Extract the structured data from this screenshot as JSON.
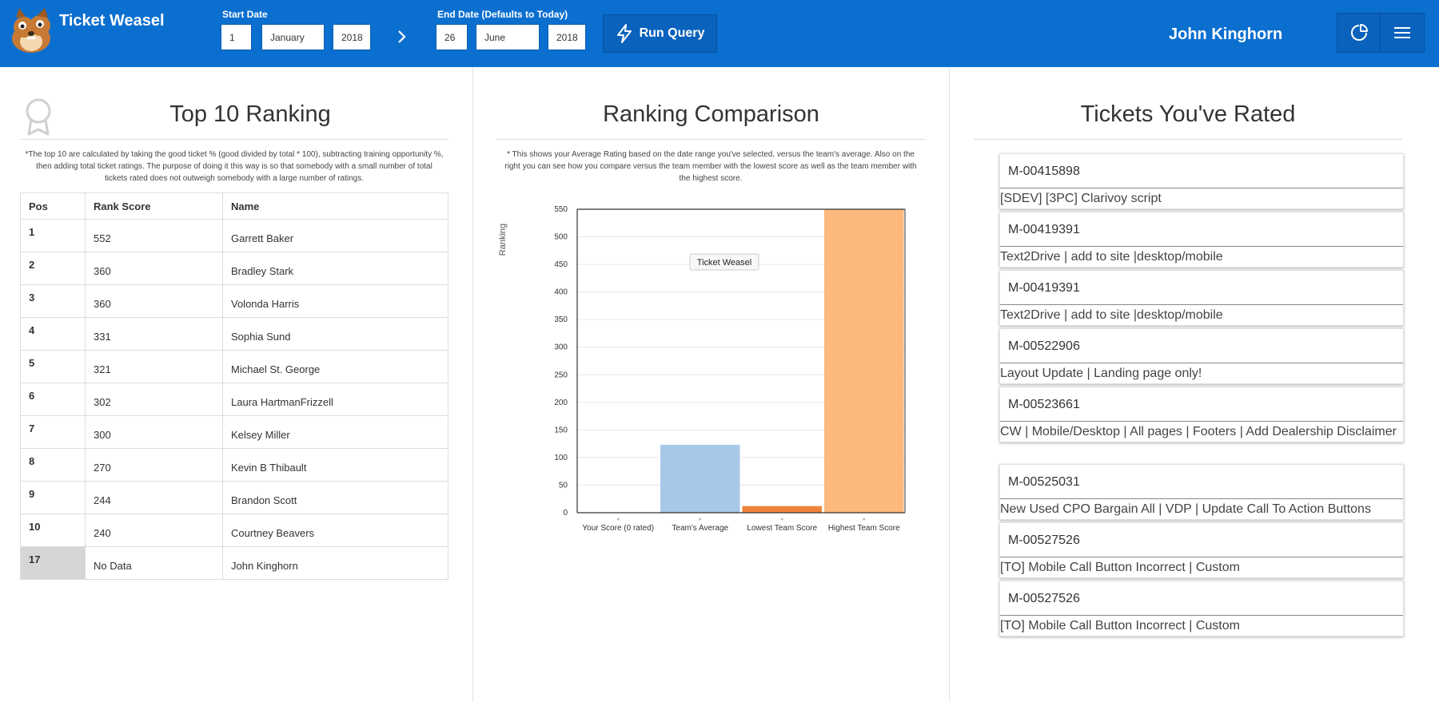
{
  "app": {
    "title": "Ticket Weasel"
  },
  "header": {
    "start_label": "Start Date",
    "start": {
      "day": "1",
      "month": "January",
      "year": "2018"
    },
    "end_label": "End Date (Defaults to Today)",
    "end": {
      "day": "26",
      "month": "June",
      "year": "2018"
    },
    "run_label": "Run Query",
    "user_name": "John Kinghorn"
  },
  "top10": {
    "title": "Top 10 Ranking",
    "note": "*The top 10 are calculated by taking the good ticket % (good divided by total * 100), subtracting training opportunity %, then adding total ticket ratings. The purpose of doing it this way is so that somebody with a small number of total tickets rated does not outweigh somebody with a large number of ratings.",
    "headers": [
      "Pos",
      "Rank Score",
      "Name"
    ],
    "rows": [
      {
        "pos": "1",
        "score": "552",
        "name": "Garrett Baker"
      },
      {
        "pos": "2",
        "score": "360",
        "name": "Bradley Stark"
      },
      {
        "pos": "3",
        "score": "360",
        "name": "Volonda Harris"
      },
      {
        "pos": "4",
        "score": "331",
        "name": "Sophia Sund"
      },
      {
        "pos": "5",
        "score": "321",
        "name": "Michael St. George"
      },
      {
        "pos": "6",
        "score": "302",
        "name": "Laura HartmanFrizzell"
      },
      {
        "pos": "7",
        "score": "300",
        "name": "Kelsey Miller"
      },
      {
        "pos": "8",
        "score": "270",
        "name": "Kevin B Thibault"
      },
      {
        "pos": "9",
        "score": "244",
        "name": "Brandon Scott"
      },
      {
        "pos": "10",
        "score": "240",
        "name": "Courtney Beavers"
      }
    ],
    "me": {
      "pos": "17",
      "score": "No Data",
      "name": "John Kinghorn"
    }
  },
  "comparison": {
    "title": "Ranking Comparison",
    "note": "* This shows your Average Rating based on the date range you've selected, versus the team's average. Also on the right you can see how you compare versus the team member with the lowest score as well as the team member with the highest score."
  },
  "chart_data": {
    "type": "bar",
    "categories": [
      "Your Score (0 rated)",
      "Team's Average",
      "Lowest Team Score",
      "Highest Team Score"
    ],
    "values": [
      0,
      123,
      12,
      552
    ],
    "colors": [
      "#a8c8e8",
      "#a8c8e8",
      "#f0823a",
      "#fdb97c"
    ],
    "ylabel": "Ranking",
    "ylim": [
      0,
      550
    ],
    "yticks": [
      0,
      50,
      100,
      150,
      200,
      250,
      300,
      350,
      400,
      450,
      500,
      550
    ],
    "grid": true,
    "watermark": "Ticket Weasel"
  },
  "tickets": {
    "title": "Tickets You've Rated",
    "items": [
      {
        "id": "M-00415898",
        "desc": "[SDEV] [3PC] Clarivoy script"
      },
      {
        "id": "M-00419391",
        "desc": "Text2Drive | add to site |desktop/mobile"
      },
      {
        "id": "M-00419391",
        "desc": "Text2Drive | add to site |desktop/mobile"
      },
      {
        "id": "M-00522906",
        "desc": "Layout Update | Landing page only!"
      },
      {
        "id": "M-00523661",
        "desc": "CW | Mobile/Desktop | All pages | Footers | Add Dealership Disclaimer"
      },
      {
        "id": "M-00525031",
        "desc": "New Used CPO Bargain All | VDP | Update Call To Action Buttons"
      },
      {
        "id": "M-00527526",
        "desc": "[TO] Mobile Call Button Incorrect | Custom"
      },
      {
        "id": "M-00527526",
        "desc": "[TO] Mobile Call Button Incorrect | Custom"
      }
    ]
  },
  "icons": {
    "logo": "weasel-logo",
    "chevron": "chevron-right-icon",
    "run": "lightning-bolt-icon",
    "chart": "pie-chart-icon",
    "menu": "hamburger-menu-icon",
    "award": "award-ribbon-icon"
  },
  "colors": {
    "header_bg": "#0b6fd0",
    "button_bg": "#0a62bd"
  }
}
